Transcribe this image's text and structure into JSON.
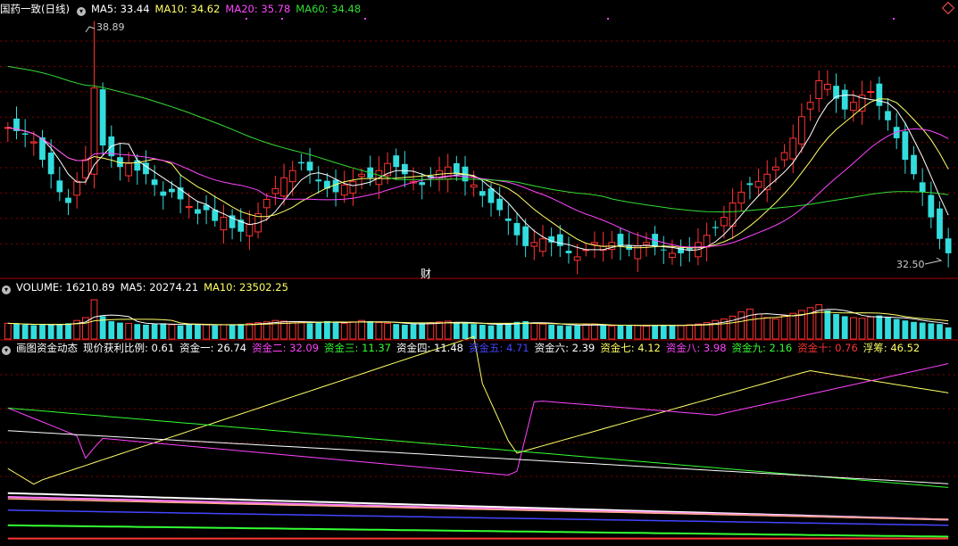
{
  "price_header": {
    "name": "国药一致(日线)",
    "items": [
      {
        "text": "MA5: 33.44",
        "color": "#ffffff"
      },
      {
        "text": "MA10: 34.62",
        "color": "#ffff66"
      },
      {
        "text": "MA20: 35.78",
        "color": "#ff44ff"
      },
      {
        "text": "MA60: 34.48",
        "color": "#33dd33"
      }
    ]
  },
  "volume_header": {
    "items": [
      {
        "text": "VOLUME: 16210.89",
        "color": "#ffffff"
      },
      {
        "text": "MA5: 20274.21",
        "color": "#ffffff"
      },
      {
        "text": "MA10: 23502.25",
        "color": "#ffff66"
      }
    ]
  },
  "indicator_header": {
    "items": [
      {
        "text": "画图资金动态",
        "color": "#ffffff"
      },
      {
        "text": "现价获利比例: 0.61",
        "color": "#ffffff"
      },
      {
        "text": "资金一: 26.74",
        "color": "#ffffff"
      },
      {
        "text": "资金二: 32.09",
        "color": "#ff44ff"
      },
      {
        "text": "资金三: 11.37",
        "color": "#33ff33"
      },
      {
        "text": "资金四: 11.48",
        "color": "#ffffff"
      },
      {
        "text": "资金五: 4.71",
        "color": "#4444ff"
      },
      {
        "text": "资金六: 2.39",
        "color": "#ffffff"
      },
      {
        "text": "资金七: 4.12",
        "color": "#ffff66"
      },
      {
        "text": "资金八: 3.98",
        "color": "#ff44ff"
      },
      {
        "text": "资金九: 2.16",
        "color": "#33ff33"
      },
      {
        "text": "资金十: 0.76",
        "color": "#ff3333"
      },
      {
        "text": "浮筹: 46.52",
        "color": "#ffff66"
      }
    ]
  },
  "annotations": {
    "high_label": "38.89",
    "low_label": "32.50",
    "event_marker": "财"
  },
  "colors": {
    "up": "#ff3333",
    "down": "#33dddd",
    "grid": "#880000",
    "ma5": "#ffffff",
    "ma10": "#ffff66",
    "ma20": "#ff44ff",
    "ma60": "#33dd33"
  },
  "chart_data": [
    {
      "type": "candlestick",
      "y_range": [
        32.2,
        39.2
      ],
      "note_values": "approximate close series",
      "close": [
        36.1,
        36.0,
        35.9,
        35.7,
        35.2,
        34.8,
        34.3,
        34.0,
        34.6,
        35.2,
        37.2,
        35.6,
        35.3,
        35.0,
        35.1,
        34.9,
        34.8,
        34.5,
        34.2,
        34.3,
        34.1,
        33.9,
        33.7,
        33.8,
        33.5,
        33.6,
        33.3,
        33.2,
        33.4,
        33.7,
        34.1,
        34.4,
        34.7,
        34.9,
        35.1,
        34.9,
        34.6,
        34.4,
        34.3,
        34.5,
        34.6,
        34.8,
        34.7,
        34.9,
        35.1,
        35.0,
        34.8,
        34.6,
        34.5,
        34.7,
        34.9,
        35.0,
        34.8,
        34.6,
        34.5,
        34.2,
        34.0,
        33.8,
        33.5,
        33.1,
        32.8,
        32.9,
        33.0,
        32.9,
        32.8,
        32.6,
        32.5,
        32.7,
        32.9,
        32.8,
        32.9,
        32.8,
        32.7,
        32.8,
        32.9,
        32.8,
        32.7,
        32.6,
        32.6,
        32.7,
        32.9,
        33.1,
        33.3,
        33.6,
        34.0,
        34.3,
        34.5,
        34.6,
        34.8,
        35.0,
        35.4,
        35.8,
        36.4,
        36.8,
        37.4,
        37.3,
        36.9,
        36.6,
        36.8,
        37.0,
        37.1,
        36.7,
        36.3,
        35.8,
        35.2,
        34.8,
        34.3,
        33.6,
        33.0,
        32.6
      ]
    },
    {
      "type": "bar",
      "name": "VOLUME",
      "y_range": [
        0,
        60000
      ],
      "values": [
        22000,
        21000,
        20000,
        19500,
        20500,
        20000,
        21000,
        22000,
        26000,
        30000,
        55000,
        32000,
        25000,
        23000,
        22000,
        21000,
        20000,
        21000,
        22000,
        20000,
        19000,
        20000,
        21000,
        20000,
        19000,
        20000,
        19500,
        21000,
        22000,
        23000,
        24000,
        26000,
        25000,
        24000,
        23000,
        22000,
        24000,
        25000,
        23000,
        22000,
        24000,
        26000,
        25000,
        23000,
        22000,
        21000,
        20000,
        21000,
        22000,
        23000,
        24000,
        25000,
        23000,
        22000,
        21000,
        20000,
        19000,
        21000,
        22000,
        24000,
        25000,
        22000,
        21000,
        20000,
        19000,
        18500,
        19000,
        20000,
        21000,
        19000,
        18000,
        19000,
        20000,
        19000,
        18000,
        19000,
        20000,
        19500,
        19000,
        20000,
        21000,
        23000,
        26000,
        28000,
        32000,
        38000,
        42000,
        35000,
        30000,
        28000,
        33000,
        36000,
        40000,
        44000,
        48000,
        40000,
        35000,
        32000,
        30000,
        29000,
        31000,
        33000,
        30000,
        28000,
        26000,
        24000,
        23000,
        22000,
        21000,
        16210
      ]
    },
    {
      "type": "line",
      "name": "资金动态",
      "y_range": [
        0,
        100
      ]
    }
  ]
}
